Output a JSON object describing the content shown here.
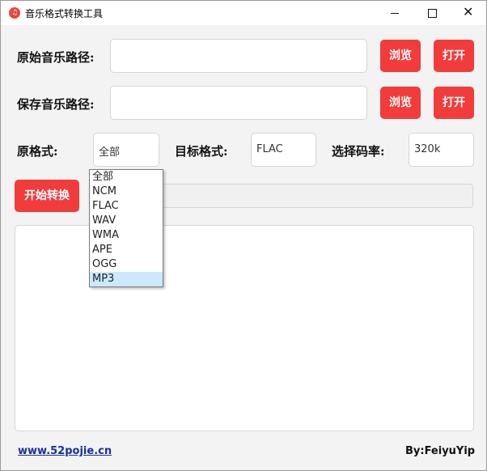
{
  "window": {
    "title": "音乐格式转换工具",
    "icon": "music-note-icon",
    "controls": {
      "minimize": "minimize-icon",
      "maximize": "maximize-icon",
      "close": "close-icon"
    }
  },
  "source": {
    "label": "原始音乐路径:",
    "value": "",
    "browse_label": "浏览",
    "open_label": "打开"
  },
  "save": {
    "label": "保存音乐路径:",
    "value": "",
    "browse_label": "浏览",
    "open_label": "打开"
  },
  "formats": {
    "source_label": "原格式:",
    "source_value": "全部",
    "target_label": "目标格式:",
    "target_value": "FLAC",
    "bitrate_label": "选择码率:",
    "bitrate_value": "320k"
  },
  "start_label": "开始转换",
  "progress": 0,
  "log_text": "",
  "dropdown": {
    "options": [
      "全部",
      "NCM",
      "FLAC",
      "WAV",
      "WMA",
      "APE",
      "OGG",
      "MP3"
    ],
    "highlighted": "MP3"
  },
  "footer": {
    "link": "www.52pojie.cn",
    "credit": "By:FeiyuYip"
  },
  "colors": {
    "accent": "#f23b3b",
    "highlight": "#cce8ff",
    "link": "#1a2f9c"
  }
}
